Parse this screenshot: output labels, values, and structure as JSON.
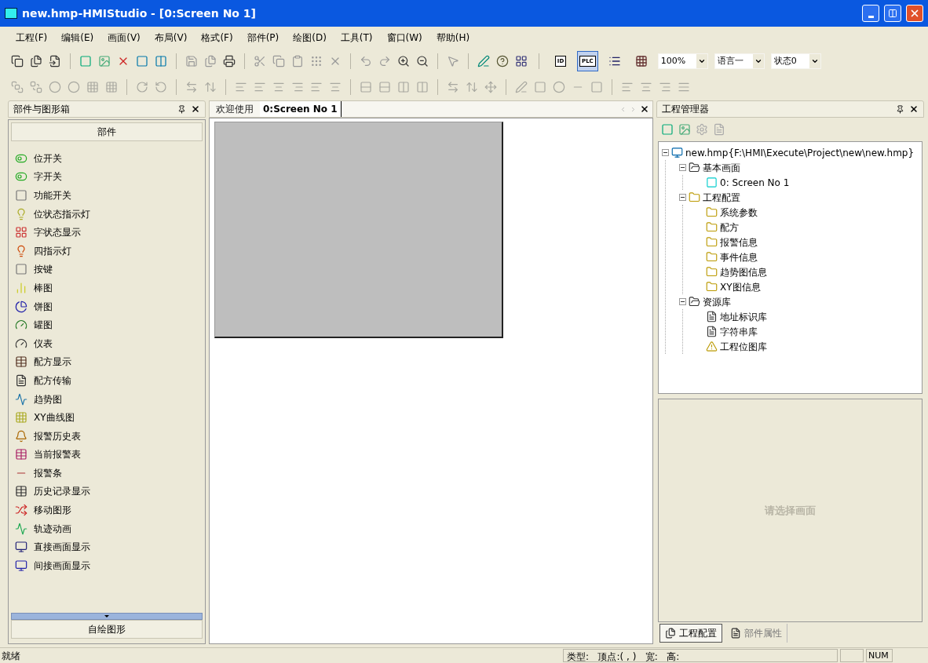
{
  "window": {
    "title": "new.hmp-HMIStudio - [0:Screen No 1]"
  },
  "menu": [
    "工程(F)",
    "编辑(E)",
    "画面(V)",
    "布局(V)",
    "格式(F)",
    "部件(P)",
    "绘图(D)",
    "工具(T)",
    "窗口(W)",
    "帮助(H)"
  ],
  "view_toggles": [
    {
      "kind": "text",
      "label": "ID",
      "selected": false
    },
    {
      "kind": "text",
      "label": "PLC",
      "selected": true
    },
    {
      "kind": "list",
      "selected": false
    },
    {
      "kind": "grid",
      "selected": false
    }
  ],
  "combos": [
    {
      "value": "100%"
    },
    {
      "value": "语言一"
    },
    {
      "value": "状态0"
    }
  ],
  "left_panel": {
    "title": "部件与图形箱",
    "section": "部件",
    "items": [
      "位开关",
      "字开关",
      "功能开关",
      "位状态指示灯",
      "字状态显示",
      "四指示灯",
      "按键",
      "棒图",
      "饼图",
      "罐图",
      "仪表",
      "配方显示",
      "配方传输",
      "趋势图",
      "XY曲线图",
      "报警历史表",
      "当前报警表",
      "报警条",
      "历史记录显示",
      "移动图形",
      "轨迹动画",
      "直接画面显示",
      "间接画面显示"
    ],
    "footer": "自绘图形"
  },
  "document_tabs": [
    {
      "label": "欢迎使用",
      "selected": false
    },
    {
      "label": "0:Screen No 1",
      "selected": true
    }
  ],
  "right_panel": {
    "title": "工程管理器",
    "tree": [
      {
        "kind": "project",
        "label": "new.hmp{F:\\HMI\\Execute\\Project\\new\\new.hmp}",
        "expanded": true,
        "children": [
          {
            "kind": "library",
            "label": "基本画面",
            "expanded": true,
            "children": [
              {
                "kind": "screen",
                "label": "0: Screen No 1"
              }
            ]
          },
          {
            "kind": "config",
            "label": "工程配置",
            "expanded": true,
            "children": [
              {
                "kind": "config",
                "label": "系统参数"
              },
              {
                "kind": "config",
                "label": "配方"
              },
              {
                "kind": "config",
                "label": "报警信息"
              },
              {
                "kind": "config",
                "label": "事件信息"
              },
              {
                "kind": "config",
                "label": "趋势图信息"
              },
              {
                "kind": "config",
                "label": "XY图信息"
              }
            ]
          },
          {
            "kind": "library",
            "label": "资源库",
            "expanded": true,
            "children": [
              {
                "kind": "document",
                "label": "地址标识库"
              },
              {
                "kind": "document",
                "label": "字符串库"
              },
              {
                "kind": "warning",
                "label": "工程位图库"
              }
            ]
          }
        ]
      }
    ],
    "properties_hint": "请选择画面",
    "tabs": [
      {
        "label": "工程配置",
        "selected": true
      },
      {
        "label": "部件属性",
        "selected": false
      }
    ]
  },
  "status_bar": {
    "message": "就绪",
    "info": "类型:   顶点:( , )   宽:   高:",
    "num": "NUM"
  }
}
